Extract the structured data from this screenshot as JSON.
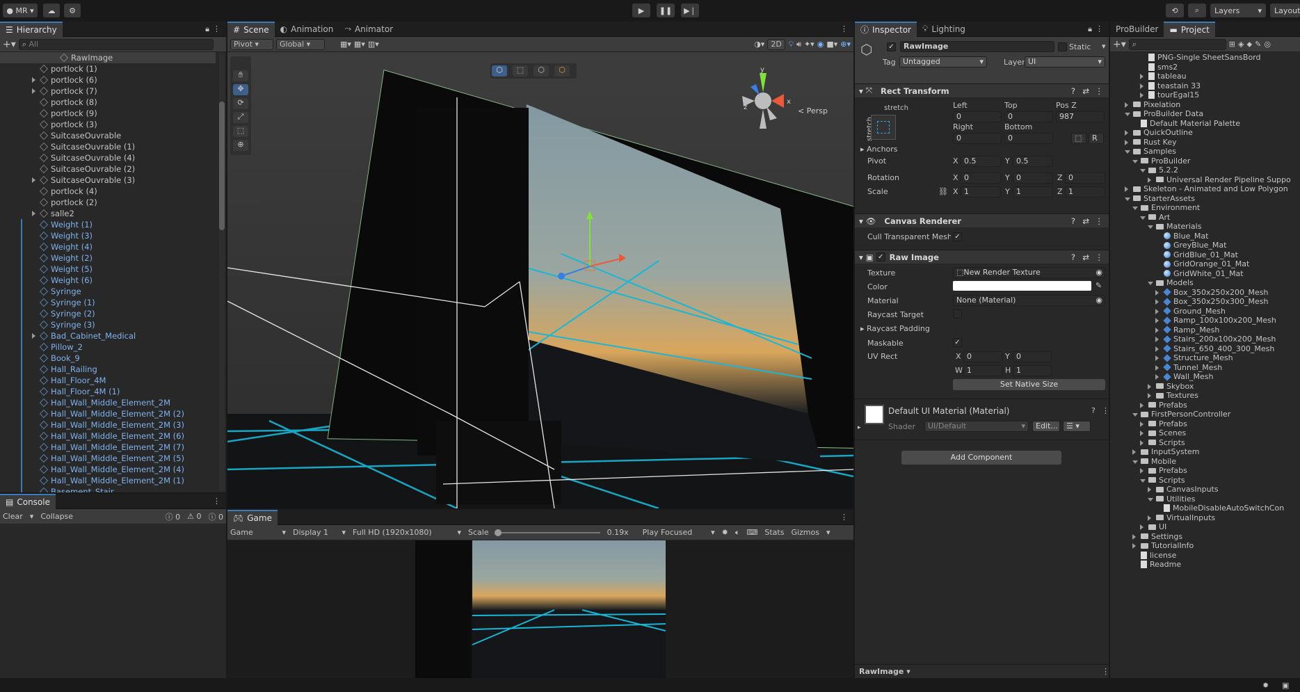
{
  "toolbar": {
    "account": "MR",
    "play_icon": "play-icon",
    "pause_icon": "pause-icon",
    "step_icon": "step-icon",
    "layers": "Layers",
    "layout": "Layout"
  },
  "hierarchy": {
    "tab": "Hierarchy",
    "search_placeholder": "All",
    "rows": [
      {
        "label": "RawImage",
        "blue": false,
        "sel": true,
        "arrow": false,
        "indent": 1
      },
      {
        "label": "portlock (1)",
        "blue": false,
        "arrow": false,
        "indent": 0
      },
      {
        "label": "portlock (6)",
        "blue": false,
        "arrow": true,
        "indent": 0
      },
      {
        "label": "portlock (7)",
        "blue": false,
        "arrow": true,
        "indent": 0
      },
      {
        "label": "portlock (8)",
        "blue": false,
        "arrow": false,
        "indent": 0
      },
      {
        "label": "portlock (9)",
        "blue": false,
        "arrow": false,
        "indent": 0
      },
      {
        "label": "portlock (3)",
        "blue": false,
        "arrow": false,
        "indent": 0
      },
      {
        "label": "SuitcaseOuvrable",
        "blue": false,
        "arrow": false,
        "indent": 0
      },
      {
        "label": "SuitcaseOuvrable (1)",
        "blue": false,
        "arrow": false,
        "indent": 0
      },
      {
        "label": "SuitcaseOuvrable (4)",
        "blue": false,
        "arrow": false,
        "indent": 0
      },
      {
        "label": "SuitcaseOuvrable (2)",
        "blue": false,
        "arrow": false,
        "indent": 0
      },
      {
        "label": "SuitcaseOuvrable (3)",
        "blue": false,
        "arrow": true,
        "indent": 0
      },
      {
        "label": "portlock (4)",
        "blue": false,
        "arrow": false,
        "indent": 0
      },
      {
        "label": "portlock (2)",
        "blue": false,
        "arrow": false,
        "indent": 0
      },
      {
        "label": "salle2",
        "blue": false,
        "arrow": true,
        "indent": 0
      },
      {
        "label": "Weight (1)",
        "blue": true,
        "arrow": false,
        "indent": 0
      },
      {
        "label": "Weight (3)",
        "blue": true,
        "arrow": false,
        "indent": 0
      },
      {
        "label": "Weight (4)",
        "blue": true,
        "arrow": false,
        "indent": 0
      },
      {
        "label": "Weight (2)",
        "blue": true,
        "arrow": false,
        "indent": 0
      },
      {
        "label": "Weight (5)",
        "blue": true,
        "arrow": false,
        "indent": 0
      },
      {
        "label": "Weight (6)",
        "blue": true,
        "arrow": false,
        "indent": 0
      },
      {
        "label": "Syringe",
        "blue": true,
        "arrow": false,
        "indent": 0
      },
      {
        "label": "Syringe (1)",
        "blue": true,
        "arrow": false,
        "indent": 0
      },
      {
        "label": "Syringe (2)",
        "blue": true,
        "arrow": false,
        "indent": 0
      },
      {
        "label": "Syringe (3)",
        "blue": true,
        "arrow": false,
        "indent": 0
      },
      {
        "label": "Bad_Cabinet_Medical",
        "blue": true,
        "arrow": true,
        "indent": 0
      },
      {
        "label": "Pillow_2",
        "blue": true,
        "arrow": false,
        "indent": 0
      },
      {
        "label": "Book_9",
        "blue": true,
        "arrow": false,
        "indent": 0
      },
      {
        "label": "Hall_Railing",
        "blue": true,
        "arrow": false,
        "indent": 0
      },
      {
        "label": "Hall_Floor_4M",
        "blue": true,
        "arrow": false,
        "indent": 0
      },
      {
        "label": "Hall_Floor_4M (1)",
        "blue": true,
        "arrow": false,
        "indent": 0
      },
      {
        "label": "Hall_Wall_Middle_Element_2M",
        "blue": true,
        "arrow": false,
        "indent": 0
      },
      {
        "label": "Hall_Wall_Middle_Element_2M (2)",
        "blue": true,
        "arrow": false,
        "indent": 0
      },
      {
        "label": "Hall_Wall_Middle_Element_2M (3)",
        "blue": true,
        "arrow": false,
        "indent": 0
      },
      {
        "label": "Hall_Wall_Middle_Element_2M (6)",
        "blue": true,
        "arrow": false,
        "indent": 0
      },
      {
        "label": "Hall_Wall_Middle_Element_2M (7)",
        "blue": true,
        "arrow": false,
        "indent": 0
      },
      {
        "label": "Hall_Wall_Middle_Element_2M (5)",
        "blue": true,
        "arrow": false,
        "indent": 0
      },
      {
        "label": "Hall_Wall_Middle_Element_2M (4)",
        "blue": true,
        "arrow": false,
        "indent": 0
      },
      {
        "label": "Hall_Wall_Middle_Element_2M (1)",
        "blue": true,
        "arrow": false,
        "indent": 0
      },
      {
        "label": "Basement_Stair",
        "blue": true,
        "arrow": false,
        "indent": 0
      }
    ]
  },
  "console": {
    "tab": "Console",
    "clear": "Clear",
    "collapse": "Collapse",
    "log_count": "0",
    "warn_count": "0",
    "err_count": "0"
  },
  "scene": {
    "tabs": [
      "Scene",
      "Animation",
      "Animator"
    ],
    "pivot": "Pivot",
    "global": "Global",
    "mode_2d": "2D",
    "persp": "< Persp"
  },
  "game": {
    "tab": "Game",
    "display_type": "Game",
    "display": "Display 1",
    "resolution": "Full HD (1920x1080)",
    "scale_label": "Scale",
    "scale_value": "0.19x",
    "play_focused": "Play Focused",
    "stats": "Stats",
    "gizmos": "Gizmos"
  },
  "inspector": {
    "tabs": [
      "Inspector",
      "Lighting"
    ],
    "name": "RawImage",
    "static": "Static",
    "tag_label": "Tag",
    "tag": "Untagged",
    "layer_label": "Layer",
    "layer": "UI",
    "rect": {
      "title": "Rect Transform",
      "stretch_top": "stretch",
      "stretch_side": "stretch",
      "left_l": "Left",
      "top_l": "Top",
      "posz_l": "Pos Z",
      "left": "0",
      "top": "0",
      "posz": "987",
      "right_l": "Right",
      "bottom_l": "Bottom",
      "right": "0",
      "bottom": "0",
      "r_btn": "R",
      "anchors": "Anchors",
      "pivot": "Pivot",
      "pivot_x": "0.5",
      "pivot_y": "0.5",
      "rotation": "Rotation",
      "rot_x": "0",
      "rot_y": "0",
      "rot_z": "0",
      "scale": "Scale",
      "sc_x": "1",
      "sc_y": "1",
      "sc_z": "1"
    },
    "canvas": {
      "title": "Canvas Renderer",
      "cull": "Cull Transparent Mesh"
    },
    "raw": {
      "title": "Raw Image",
      "texture_l": "Texture",
      "texture": "New Render Texture",
      "color_l": "Color",
      "material_l": "Material",
      "material": "None (Material)",
      "raycast_l": "Raycast Target",
      "padding_l": "Raycast Padding",
      "maskable_l": "Maskable",
      "uvrect_l": "UV Rect",
      "uv_x": "0",
      "uv_y": "0",
      "uv_w": "1",
      "uv_h": "1",
      "native": "Set Native Size"
    },
    "mat": {
      "title": "Default UI Material (Material)",
      "shader_l": "Shader",
      "shader": "UI/Default",
      "edit": "Edit..."
    },
    "add": "Add Component",
    "footer": "RawImage",
    "axis": {
      "x": "X",
      "y": "Y",
      "z": "Z",
      "w": "W",
      "h": "H"
    }
  },
  "project": {
    "tabs": [
      "ProBuilder",
      "Project"
    ],
    "rows": [
      {
        "label": "PNG-Single SheetSansBord",
        "icon": "file",
        "d": 3,
        "a": "none"
      },
      {
        "label": "sms2",
        "icon": "file",
        "d": 3,
        "a": "none"
      },
      {
        "label": "tableau",
        "icon": "file",
        "d": 3,
        "a": "right"
      },
      {
        "label": "teastain 33",
        "icon": "file",
        "d": 3,
        "a": "right"
      },
      {
        "label": "tourEgal15",
        "icon": "file",
        "d": 3,
        "a": "right"
      },
      {
        "label": "Pixelation",
        "icon": "folder",
        "d": 1,
        "a": "right"
      },
      {
        "label": "ProBuilder Data",
        "icon": "folder",
        "d": 1,
        "a": "down"
      },
      {
        "label": "Default Material Palette",
        "icon": "file",
        "d": 2,
        "a": "none"
      },
      {
        "label": "QuickOutline",
        "icon": "folder",
        "d": 1,
        "a": "right"
      },
      {
        "label": "Rust Key",
        "icon": "folder",
        "d": 1,
        "a": "right"
      },
      {
        "label": "Samples",
        "icon": "folder",
        "d": 1,
        "a": "down"
      },
      {
        "label": "ProBuilder",
        "icon": "folder",
        "d": 2,
        "a": "down"
      },
      {
        "label": "5.2.2",
        "icon": "folder",
        "d": 3,
        "a": "down"
      },
      {
        "label": "Universal Render Pipeline Suppo",
        "icon": "folder",
        "d": 4,
        "a": "right"
      },
      {
        "label": "Skeleton - Animated and Low Polygon",
        "icon": "folder",
        "d": 1,
        "a": "right"
      },
      {
        "label": "StarterAssets",
        "icon": "folder",
        "d": 1,
        "a": "down"
      },
      {
        "label": "Environment",
        "icon": "folder",
        "d": 2,
        "a": "down"
      },
      {
        "label": "Art",
        "icon": "folder",
        "d": 3,
        "a": "down"
      },
      {
        "label": "Materials",
        "icon": "folder",
        "d": 4,
        "a": "down"
      },
      {
        "label": "Blue_Mat",
        "icon": "mat",
        "d": 5,
        "a": "none"
      },
      {
        "label": "GreyBlue_Mat",
        "icon": "mat",
        "d": 5,
        "a": "none"
      },
      {
        "label": "GridBlue_01_Mat",
        "icon": "mat",
        "d": 5,
        "a": "none"
      },
      {
        "label": "GridOrange_01_Mat",
        "icon": "mat",
        "d": 5,
        "a": "none"
      },
      {
        "label": "GridWhite_01_Mat",
        "icon": "mat",
        "d": 5,
        "a": "none"
      },
      {
        "label": "Models",
        "icon": "folder",
        "d": 4,
        "a": "down"
      },
      {
        "label": "Box_350x250x200_Mesh",
        "icon": "mesh",
        "d": 5,
        "a": "right"
      },
      {
        "label": "Box_350x250x300_Mesh",
        "icon": "mesh",
        "d": 5,
        "a": "right"
      },
      {
        "label": "Ground_Mesh",
        "icon": "mesh",
        "d": 5,
        "a": "right"
      },
      {
        "label": "Ramp_100x100x200_Mesh",
        "icon": "mesh",
        "d": 5,
        "a": "right"
      },
      {
        "label": "Ramp_Mesh",
        "icon": "mesh",
        "d": 5,
        "a": "right"
      },
      {
        "label": "Stairs_200x100x200_Mesh",
        "icon": "mesh",
        "d": 5,
        "a": "right"
      },
      {
        "label": "Stairs_650_400_300_Mesh",
        "icon": "mesh",
        "d": 5,
        "a": "right"
      },
      {
        "label": "Structure_Mesh",
        "icon": "mesh",
        "d": 5,
        "a": "right"
      },
      {
        "label": "Tunnel_Mesh",
        "icon": "mesh",
        "d": 5,
        "a": "right"
      },
      {
        "label": "Wall_Mesh",
        "icon": "mesh",
        "d": 5,
        "a": "right"
      },
      {
        "label": "Skybox",
        "icon": "folder",
        "d": 4,
        "a": "right"
      },
      {
        "label": "Textures",
        "icon": "folder",
        "d": 4,
        "a": "right"
      },
      {
        "label": "Prefabs",
        "icon": "folder",
        "d": 3,
        "a": "right"
      },
      {
        "label": "FirstPersonController",
        "icon": "folder",
        "d": 2,
        "a": "down"
      },
      {
        "label": "Prefabs",
        "icon": "folder",
        "d": 3,
        "a": "right"
      },
      {
        "label": "Scenes",
        "icon": "folder",
        "d": 3,
        "a": "right"
      },
      {
        "label": "Scripts",
        "icon": "folder",
        "d": 3,
        "a": "right"
      },
      {
        "label": "InputSystem",
        "icon": "folder",
        "d": 2,
        "a": "right"
      },
      {
        "label": "Mobile",
        "icon": "folder",
        "d": 2,
        "a": "down"
      },
      {
        "label": "Prefabs",
        "icon": "folder",
        "d": 3,
        "a": "right"
      },
      {
        "label": "Scripts",
        "icon": "folder",
        "d": 3,
        "a": "down"
      },
      {
        "label": "CanvasInputs",
        "icon": "folder",
        "d": 4,
        "a": "right"
      },
      {
        "label": "Utilities",
        "icon": "folder",
        "d": 4,
        "a": "down"
      },
      {
        "label": "MobileDisableAutoSwitchCon",
        "icon": "file",
        "d": 5,
        "a": "none"
      },
      {
        "label": "VirtualInputs",
        "icon": "folder",
        "d": 4,
        "a": "right"
      },
      {
        "label": "UI",
        "icon": "folder",
        "d": 3,
        "a": "right"
      },
      {
        "label": "Settings",
        "icon": "folder",
        "d": 2,
        "a": "right"
      },
      {
        "label": "TutorialInfo",
        "icon": "folder",
        "d": 2,
        "a": "right"
      },
      {
        "label": "license",
        "icon": "file",
        "d": 2,
        "a": "none"
      },
      {
        "label": "Readme",
        "icon": "file",
        "d": 2,
        "a": "none"
      }
    ]
  }
}
